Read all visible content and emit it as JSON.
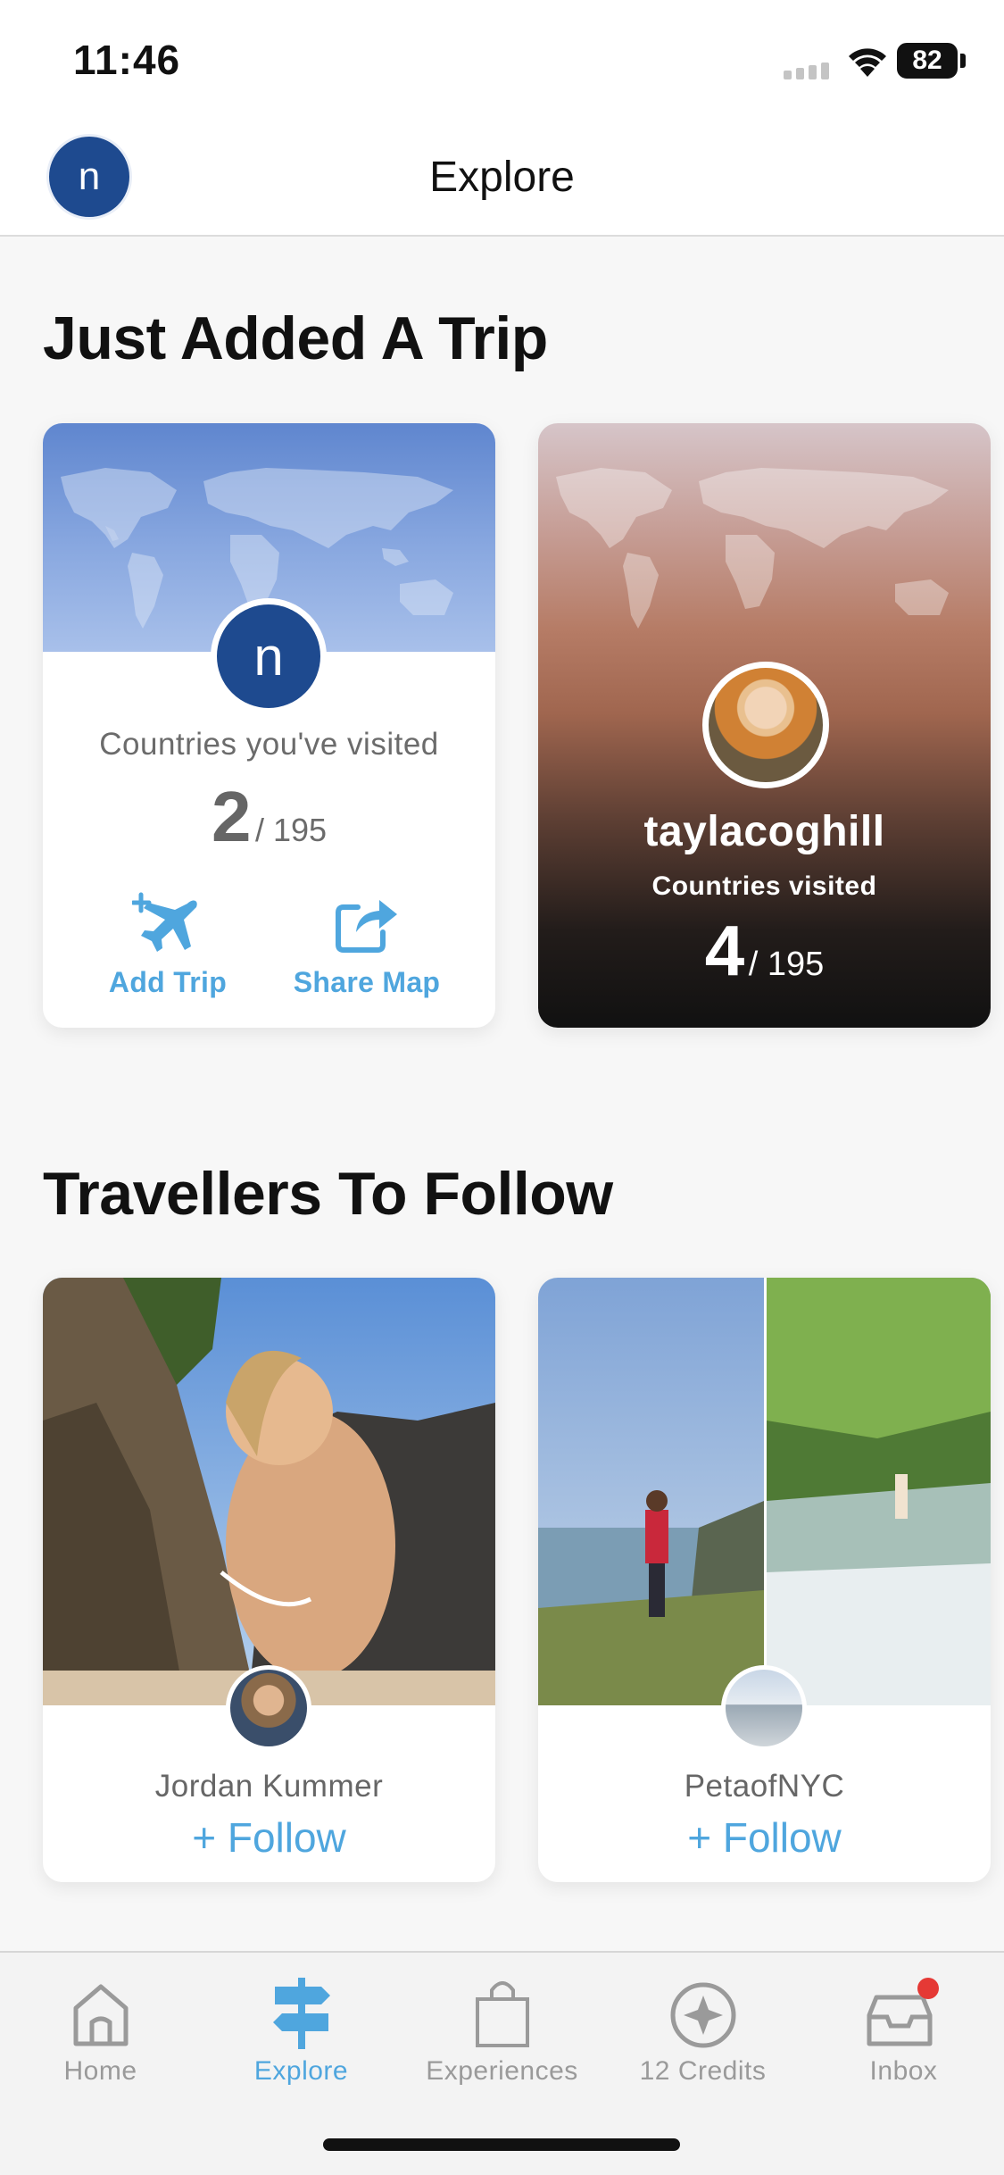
{
  "status_bar": {
    "time": "11:46",
    "battery": "82"
  },
  "header": {
    "title": "Explore",
    "avatar_initial": "n"
  },
  "trip_section": {
    "title": "Just Added A Trip",
    "my_card": {
      "avatar_initial": "n",
      "label": "Countries you've visited",
      "count": "2",
      "total": "/ 195",
      "add_trip_label": "Add Trip",
      "share_map_label": "Share Map"
    },
    "friend_card": {
      "username": "taylacoghill",
      "label": "Countries visited",
      "count": "4",
      "total": "/ 195"
    }
  },
  "travellers_section": {
    "title": "Travellers To Follow",
    "travellers": [
      {
        "name": "Jordan Kummer",
        "follow_label": "+ Follow"
      },
      {
        "name": "PetaofNYC",
        "follow_label": "+ Follow"
      }
    ]
  },
  "tab_bar": {
    "tabs": [
      {
        "label": "Home",
        "icon": "home-icon"
      },
      {
        "label": "Explore",
        "icon": "signpost-icon"
      },
      {
        "label": "Experiences",
        "icon": "shopping-bag-icon"
      },
      {
        "label": "12 Credits",
        "icon": "compass-icon"
      },
      {
        "label": "Inbox",
        "icon": "inbox-icon"
      }
    ],
    "active": "Explore"
  },
  "colors": {
    "accent": "#4fa6de",
    "avatar_blue": "#1e4a8f",
    "notification": "#e53935"
  }
}
